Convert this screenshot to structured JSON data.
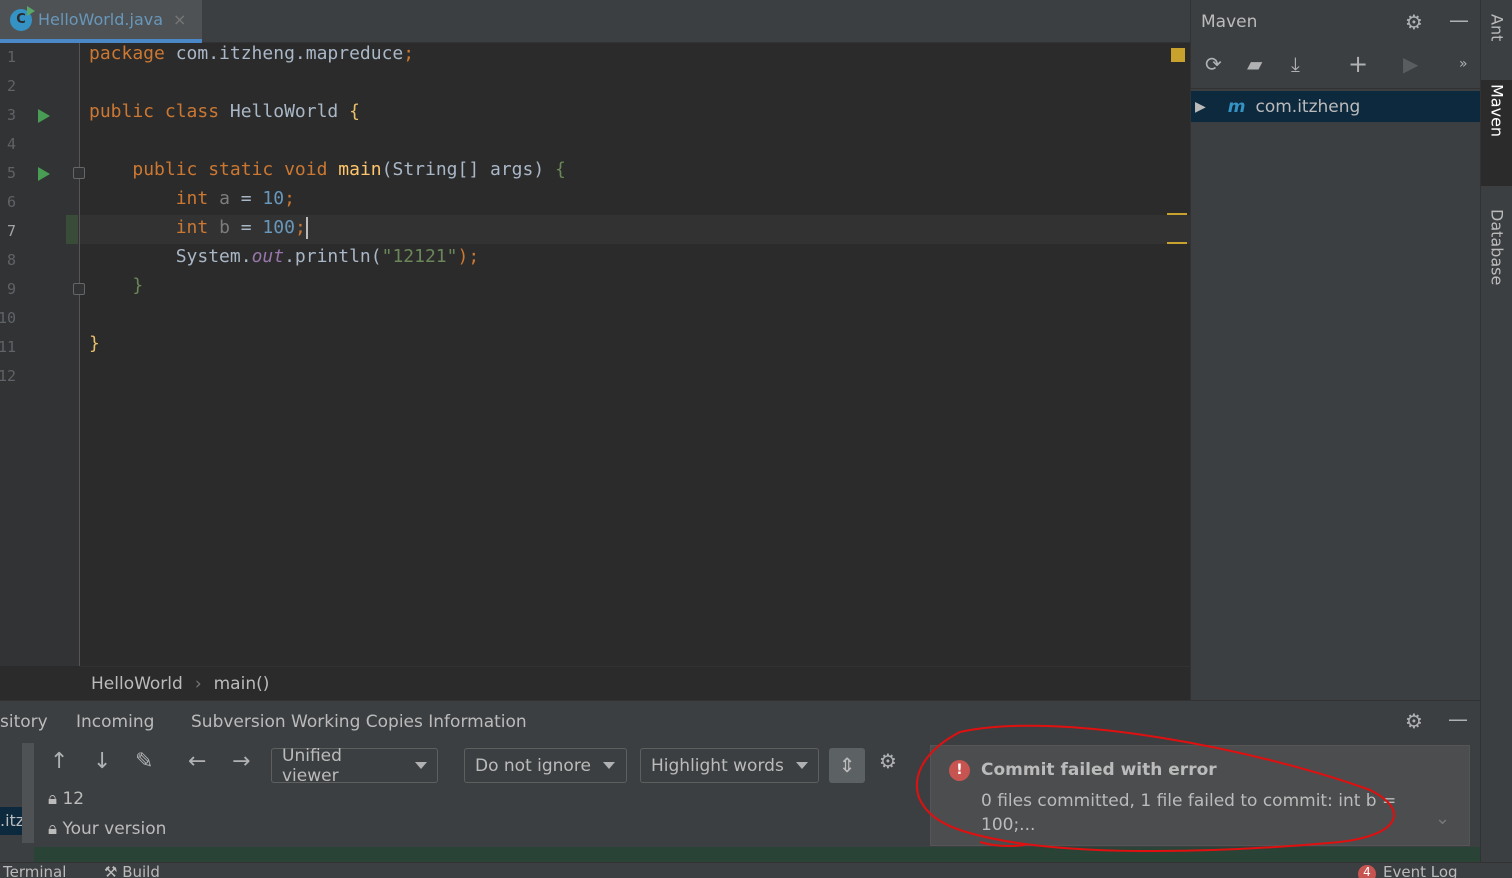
{
  "editor_tab": {
    "label": "HelloWorld.java",
    "icon": "java-class-icon",
    "close": "×"
  },
  "code_lines": [
    {
      "n": "1",
      "tokens": [
        [
          "package",
          "kw"
        ],
        [
          " com.itzheng.mapreduce",
          ""
        ],
        [
          ";",
          "kw"
        ]
      ]
    },
    {
      "n": "2",
      "tokens": []
    },
    {
      "n": "3",
      "tokens": [
        [
          "public class",
          "kw"
        ],
        [
          " HelloWorld ",
          ""
        ],
        [
          "{",
          "br"
        ]
      ]
    },
    {
      "n": "4",
      "tokens": []
    },
    {
      "n": "5",
      "tokens": [
        [
          "    ",
          " "
        ],
        [
          "public static void",
          "kw"
        ],
        [
          " ",
          ""
        ],
        [
          "main",
          "fn"
        ],
        [
          "(String[] args) ",
          ""
        ],
        [
          "{",
          "str"
        ]
      ]
    },
    {
      "n": "6",
      "tokens": [
        [
          "        ",
          ""
        ],
        [
          "int",
          "kw"
        ],
        [
          " ",
          ""
        ],
        [
          "a",
          "var"
        ],
        [
          " = ",
          ""
        ],
        [
          "10",
          "num"
        ],
        [
          ";",
          "kw"
        ]
      ]
    },
    {
      "n": "7",
      "tokens": [
        [
          "        ",
          ""
        ],
        [
          "int",
          "kw"
        ],
        [
          " ",
          ""
        ],
        [
          "b",
          "var"
        ],
        [
          " = ",
          ""
        ],
        [
          "100",
          "num"
        ],
        [
          ";",
          "kw"
        ]
      ]
    },
    {
      "n": "8",
      "tokens": [
        [
          "        System.",
          ""
        ],
        [
          "out",
          "fld"
        ],
        [
          ".println(",
          ""
        ],
        [
          "\"12121\"",
          "str"
        ],
        [
          ");",
          "kw"
        ]
      ]
    },
    {
      "n": "9",
      "tokens": [
        [
          "    ",
          ""
        ],
        [
          "}",
          "str"
        ]
      ]
    },
    {
      "n": "10",
      "tokens": []
    },
    {
      "n": "11",
      "tokens": [
        [
          "}",
          "br"
        ]
      ]
    },
    {
      "n": "12",
      "tokens": []
    }
  ],
  "breadcrumb": [
    "HelloWorld",
    "main()"
  ],
  "maven": {
    "title": "Maven",
    "tree_item": "com.itzheng",
    "more": "»"
  },
  "side_tabs": [
    "Ant",
    "Maven",
    "Database"
  ],
  "bottom": {
    "tabs": [
      "sitory",
      "Incoming",
      "Subversion Working Copies Information"
    ],
    "viewer": "Unified viewer",
    "ignore": "Do not ignore",
    "highlight": "Highlight words",
    "line_count": "12",
    "your_version": "Your version",
    "left_path": ".itzh"
  },
  "notification": {
    "title": "Commit failed with error",
    "body": "0 files committed, 1 file failed to commit: int b = 100;...",
    "accent": "#c75450"
  },
  "status": {
    "terminal": "Terminal",
    "build": "Build",
    "event_count": "4",
    "event_log": "Event Log"
  }
}
